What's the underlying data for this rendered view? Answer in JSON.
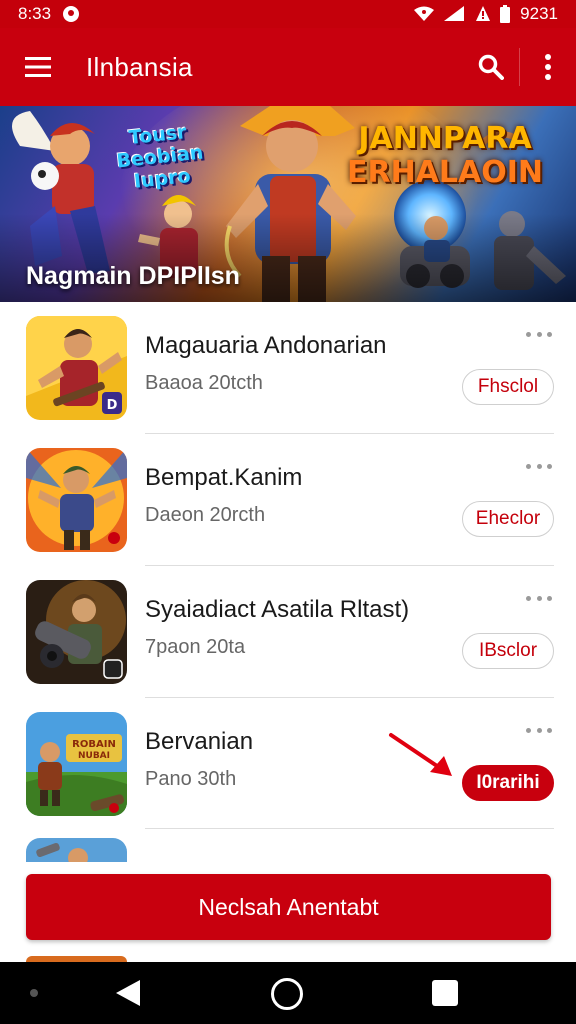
{
  "status_bar": {
    "time": "8:33",
    "battery_label": "9231"
  },
  "app_bar": {
    "title": "Ilnbansia"
  },
  "banner": {
    "text_left_lines": [
      "Tousr",
      "Beobian",
      "Iupro"
    ],
    "text_right_lines": [
      "JANNPARA",
      "ERHALAOIN"
    ],
    "caption": "Nagmain DPIPlIsn"
  },
  "items": [
    {
      "title": "Magauaria Andonarian",
      "subtitle": "Baaoa 20tcth",
      "button": "Fhsclol",
      "button_style": "outline",
      "badge": "D"
    },
    {
      "title": "Bempat.Kanim",
      "subtitle": "Daeon 20rcth",
      "button": "Eheclor",
      "button_style": "outline"
    },
    {
      "title": "Syaiadiact Asatila Rltast)",
      "subtitle": "7paon 20ta",
      "button": "IBsclor",
      "button_style": "outline"
    },
    {
      "title": "Bervanian",
      "subtitle": "Pano 30th",
      "button": "I0rarihi",
      "button_style": "filled",
      "thumb_text": [
        "ROBAIN",
        "NUBAI"
      ]
    }
  ],
  "cta": {
    "label": "Neclsah Anentabt"
  },
  "colors": {
    "primary": "#c8000e",
    "status": "#c4000b",
    "divider": "#dedede"
  },
  "icons": [
    "menu-icon",
    "search-icon",
    "more-vert-icon",
    "wifi-icon",
    "signal-icon",
    "alert-icon",
    "battery-icon",
    "back-icon",
    "home-icon",
    "recents-icon"
  ]
}
